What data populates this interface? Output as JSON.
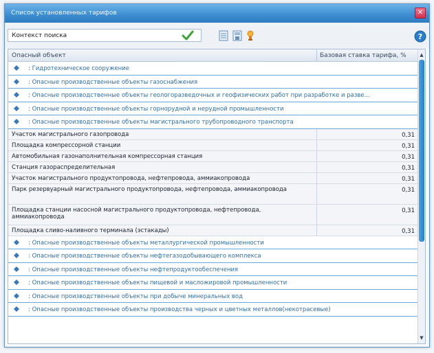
{
  "window": {
    "title": "Список установленных тарифов",
    "close_glyph": "✕"
  },
  "toolbar": {
    "search_value": "Контекст поиска",
    "icons": [
      "check-icon",
      "document-icon",
      "document-save-icon",
      "lamp-icon",
      "help-icon"
    ],
    "help_glyph": "?"
  },
  "grid": {
    "columns": {
      "object": "Опасный объект",
      "rate": "Базовая ставка тарифа, %"
    },
    "groups_top": [
      "Гидротехническое сооружение",
      "Опасные производственные объекты газоснабжения",
      "Опасные производственные объекты геологоразведочных и геофизических работ при разработке и разве...",
      "Опасные производственные объекты горнорудной и нерудной промышленности",
      "Опасные производственные объекты магистрального трубопроводного транспорта"
    ],
    "items": [
      {
        "name": "Участок магистрального газопровода",
        "rate": "0,31"
      },
      {
        "name": "Площадка компрессорной станции",
        "rate": "0,31"
      },
      {
        "name": "Автомобильная газонаполнительная компрессорная станция",
        "rate": "0,31"
      },
      {
        "name": "Станция газораспределительная",
        "rate": "0,31"
      },
      {
        "name": "Участок магистрального продуктопровода, нефтепровода, аммиакопровода",
        "rate": "0,31"
      },
      {
        "name": "Парк резервуарный магистрального продуктопровода, нефтепровода, аммиакопровода",
        "rate": "0,31"
      },
      {
        "name": "Площадка станции насосной магистрального продуктопровода, нефтепровода, аммиакопровода",
        "rate": "0,31"
      },
      {
        "name": "Площадка сливо-наливного терминала (эстакады)",
        "rate": "0,31"
      }
    ],
    "groups_bottom": [
      "Опасные производственные объекты металлургической промышленности",
      "Опасные производственные объекты нефтегазодобывающего комплекса",
      "Опасные производственные объекты нефтепродуктообеспечения",
      "Опасные производственные объекты пищевой и масложировой промышленности",
      "Опасные производственные объекты при добыче минеральных вод",
      "Опасные производственные объекты производства черных и цветных металлов(некотрасевые)"
    ],
    "group_prefix": ":",
    "scroll_up_glyph": "▲",
    "scroll_down_glyph": "▼"
  },
  "colors": {
    "titlebar": "#3f8fd2",
    "group_text": "#2f6fae",
    "group_border": "#6aa6d8",
    "scroll_thumb": "#2a7fc8",
    "check_green": "#3aa532",
    "help_blue": "#2a7fc8",
    "close_red": "#d62f4f"
  }
}
